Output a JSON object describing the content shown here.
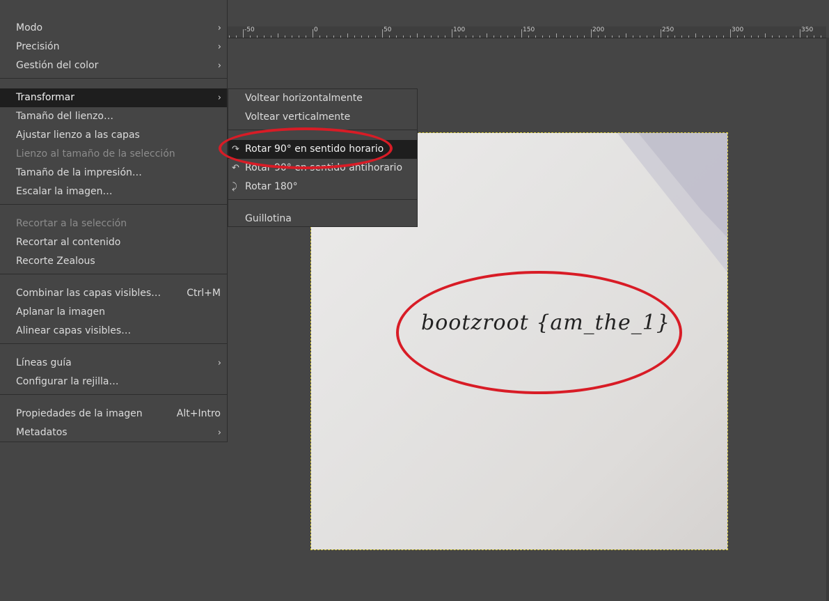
{
  "ruler": {
    "labels": [
      "-50",
      "0",
      "50",
      "100",
      "150",
      "200",
      "250",
      "300",
      "350"
    ]
  },
  "image": {
    "handwritten_text": "bootzroot {am_the_1}"
  },
  "main_menu": {
    "items": [
      {
        "label": "Modo",
        "submenu": true
      },
      {
        "label": "Precisión",
        "submenu": true
      },
      {
        "label": "Gestión del color",
        "submenu": true
      },
      {
        "label": "Transformar",
        "submenu": true,
        "highlighted": true
      },
      {
        "label": "Tamaño del lienzo…"
      },
      {
        "label": "Ajustar lienzo a las capas"
      },
      {
        "label": "Lienzo al tamaño de la selección",
        "disabled": true
      },
      {
        "label": "Tamaño de la impresión…"
      },
      {
        "label": "Escalar la imagen…"
      },
      {
        "label": "Recortar a la selección",
        "disabled": true
      },
      {
        "label": "Recortar al contenido"
      },
      {
        "label": "Recorte Zealous"
      },
      {
        "label": "Combinar las capas visibles…",
        "accel": "Ctrl+M"
      },
      {
        "label": "Aplanar la imagen"
      },
      {
        "label": "Alinear capas visibles…"
      },
      {
        "label": "Líneas guía",
        "submenu": true
      },
      {
        "label": "Configurar la rejilla…"
      },
      {
        "label": "Propiedades de la imagen",
        "accel": "Alt+Intro"
      },
      {
        "label": "Metadatos",
        "submenu": true
      }
    ],
    "arrow_glyph": "›"
  },
  "sub_menu": {
    "items": [
      {
        "label": "Voltear horizontalmente"
      },
      {
        "label": "Voltear verticalmente"
      },
      {
        "label": "Rotar 90° en sentido horario",
        "icon": "rotate-cw-icon",
        "highlighted": true
      },
      {
        "label": "Rotar 90° en sentido antihorario",
        "icon": "rotate-ccw-icon"
      },
      {
        "label": "Rotar 180°",
        "icon": "rotate-180-icon"
      },
      {
        "label": "Guillotina"
      }
    ]
  },
  "colors": {
    "background": "#454545",
    "highlight": "#1e1e1e",
    "annotation": "#d81c26",
    "selection_border": "#d9cc3c"
  }
}
